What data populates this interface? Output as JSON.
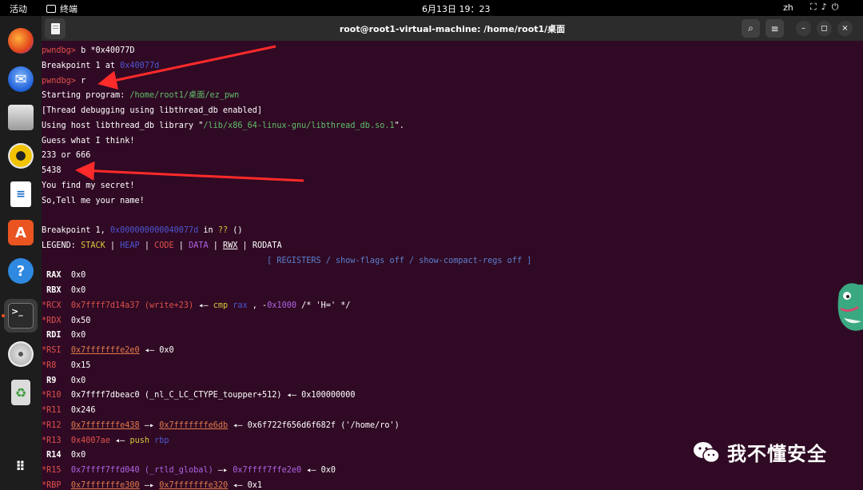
{
  "topbar": {
    "activities": "活动",
    "app_name": "终端",
    "clock": "6月13日 19：23",
    "lang": "zh"
  },
  "window": {
    "title": "root@root1-virtual-machine: /home/root1/桌面"
  },
  "terminal": {
    "lines": [
      [
        [
          "prompt",
          "pwndbg> "
        ],
        [
          "",
          "b *0x40077D"
        ]
      ],
      [
        [
          "",
          "Breakpoint 1 at "
        ],
        [
          "blue",
          "0x40077d"
        ]
      ],
      [
        [
          "prompt",
          "pwndbg> "
        ],
        [
          "",
          "r"
        ]
      ],
      [
        [
          "",
          "Starting program: "
        ],
        [
          "green",
          "/home/root1/桌面/ez_pwn"
        ]
      ],
      [
        [
          "",
          "[Thread debugging using libthread_db enabled]"
        ]
      ],
      [
        [
          "",
          "Using host libthread_db library \""
        ],
        [
          "green",
          "/lib/x86_64-linux-gnu/libthread_db.so.1"
        ],
        [
          "",
          "\"."
        ]
      ],
      [
        [
          "",
          "Guess what I think!"
        ]
      ],
      [
        [
          "",
          "233 or 666"
        ]
      ],
      [
        [
          "",
          "5438"
        ]
      ],
      [
        [
          "",
          "You find my secret!"
        ]
      ],
      [
        [
          "",
          "So,Tell me your name!"
        ]
      ],
      [
        [
          "",
          ""
        ]
      ],
      [
        [
          "",
          "Breakpoint 1, "
        ],
        [
          "blue",
          "0x000000000040077d"
        ],
        [
          "",
          " in "
        ],
        [
          "yellow",
          "??"
        ],
        [
          "",
          " ()"
        ]
      ],
      [
        [
          "",
          "LEGEND: "
        ],
        [
          "yellow",
          "STACK"
        ],
        [
          "",
          " | "
        ],
        [
          "blue",
          "HEAP"
        ],
        [
          "",
          " | "
        ],
        [
          "red",
          "CODE"
        ],
        [
          "",
          " | "
        ],
        [
          "purple",
          "DATA"
        ],
        [
          "",
          " | "
        ],
        [
          "ul",
          "RWX"
        ],
        [
          "",
          " | RODATA"
        ]
      ],
      [
        [
          "sep",
          "                                              [ REGISTERS / show-flags off / show-compact-regs off ]"
        ]
      ],
      [
        [
          "reg",
          " RAX"
        ],
        [
          "",
          "  0x0"
        ]
      ],
      [
        [
          "reg",
          " RBX"
        ],
        [
          "",
          "  0x0"
        ]
      ],
      [
        [
          "chg",
          "*RCX"
        ],
        [
          "red",
          "  0x7ffff7d14a37 (write+23)"
        ],
        [
          "",
          " ◂— "
        ],
        [
          "yellow",
          "cmp"
        ],
        [
          "",
          " "
        ],
        [
          "blue",
          "rax"
        ],
        [
          "",
          " , -"
        ],
        [
          "purple",
          "0x1000"
        ],
        [
          "",
          " /* 'H=' */"
        ]
      ],
      [
        [
          "chg",
          "*RDX"
        ],
        [
          "",
          "  0x50"
        ]
      ],
      [
        [
          "reg",
          " RDI"
        ],
        [
          "",
          "  0x0"
        ]
      ],
      [
        [
          "chg",
          "*RSI"
        ],
        [
          "",
          "  "
        ],
        [
          "orange ul",
          "0x7fffffffe2e0"
        ],
        [
          "",
          " ◂— 0x0"
        ]
      ],
      [
        [
          "chg",
          "*R8"
        ],
        [
          "",
          "   0x15"
        ]
      ],
      [
        [
          "reg",
          " R9"
        ],
        [
          "",
          "   0x0"
        ]
      ],
      [
        [
          "chg",
          "*R10"
        ],
        [
          "",
          "  0x7ffff7dbeac0 (_nl_C_LC_CTYPE_toupper+512) ◂— 0x100000000"
        ]
      ],
      [
        [
          "chg",
          "*R11"
        ],
        [
          "",
          "  0x246"
        ]
      ],
      [
        [
          "chg",
          "*R12"
        ],
        [
          "",
          "  "
        ],
        [
          "orange ul",
          "0x7fffffffe438"
        ],
        [
          "",
          " —▸ "
        ],
        [
          "orange ul",
          "0x7fffffffe6db"
        ],
        [
          "",
          " ◂— 0x6f722f656d6f682f ('/home/ro')"
        ]
      ],
      [
        [
          "chg",
          "*R13"
        ],
        [
          "red",
          "  0x4007ae"
        ],
        [
          "",
          " ◂— "
        ],
        [
          "yellow",
          "push"
        ],
        [
          "",
          " "
        ],
        [
          "blue",
          "rbp"
        ]
      ],
      [
        [
          "reg",
          " R14"
        ],
        [
          "",
          "  0x0"
        ]
      ],
      [
        [
          "chg",
          "*R15"
        ],
        [
          "",
          "  "
        ],
        [
          "purple",
          "0x7ffff7ffd040 (_rtld_global)"
        ],
        [
          "",
          " —▸ "
        ],
        [
          "purple",
          "0x7ffff7ffe2e0"
        ],
        [
          "",
          " ◂— 0x0"
        ]
      ],
      [
        [
          "chg",
          "*RBP"
        ],
        [
          "",
          "  "
        ],
        [
          "orange ul",
          "0x7fffffffe300"
        ],
        [
          "",
          " —▸ "
        ],
        [
          "orange ul",
          "0x7fffffffe320"
        ],
        [
          "",
          " ◂— 0x1"
        ]
      ]
    ]
  },
  "watermark": {
    "text": "我不懂安全"
  },
  "icons": {
    "firefox": "firefox-icon",
    "thunderbird": "thunderbird-icon",
    "files": "files-icon",
    "rhythmbox": "rhythmbox-icon",
    "writer": "writer-icon",
    "appcenter": "app-center-icon",
    "help": "help-icon",
    "terminal": "terminal-icon",
    "disc": "disc-icon",
    "trash": "trash-icon",
    "grid": "app-grid-icon"
  },
  "colors": {
    "terminal_bg": "#300a24",
    "accent_arrow": "#ff2a2a"
  }
}
